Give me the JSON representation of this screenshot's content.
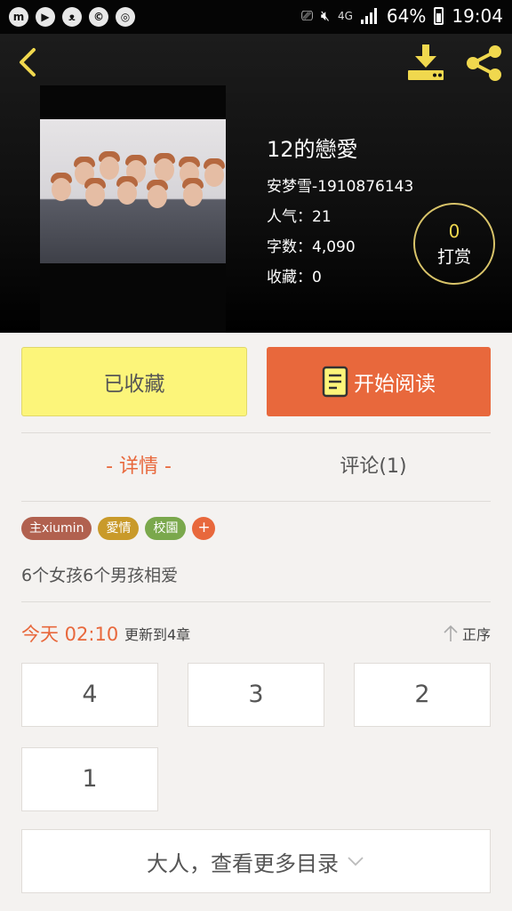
{
  "status_bar": {
    "left_icons": [
      "m-app-icon",
      "youtube-icon",
      "cat-icon",
      "c-app-icon",
      "chrome-icon"
    ],
    "network": "4G",
    "battery": "64%",
    "time": "19:04"
  },
  "book": {
    "title": "12的戀愛",
    "author": "安梦雪-1910876143",
    "popularity": "人气：21",
    "word_count": "字数：4,090",
    "favorites": "收藏：0",
    "tip_count": "0",
    "tip_label": "打赏"
  },
  "actions": {
    "favorite_label": "已收藏",
    "read_label": "开始阅读"
  },
  "tabs": {
    "detail": "- 详情 -",
    "comment": "评论(1)"
  },
  "tags": [
    {
      "label": "主xiumin",
      "color": "#b1614f"
    },
    {
      "label": "愛情",
      "color": "#c99a2a"
    },
    {
      "label": "校園",
      "color": "#7aa84c"
    }
  ],
  "tag_add": "+",
  "description": "6个女孩6个男孩相爱",
  "update": {
    "time": "今天 02:10",
    "text": "更新到4章",
    "order_label": "正序"
  },
  "chapters": [
    "4",
    "3",
    "2",
    "1"
  ],
  "more_catalog": "大人，查看更多目录",
  "colors": {
    "accent": "#e8683c",
    "favorite_bg": "#fcf57a",
    "header_icon": "#f0d84e"
  }
}
